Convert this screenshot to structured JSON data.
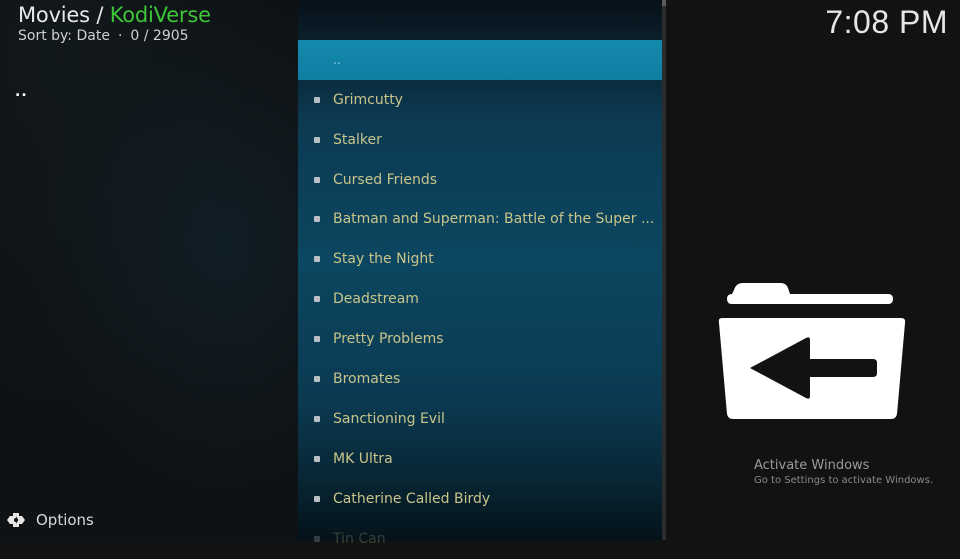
{
  "header": {
    "section": "Movies",
    "separator": " / ",
    "addon": "KodiVerse",
    "sort_label": "Sort by: Date",
    "dot": "·",
    "position": "0 / 2905"
  },
  "clock": "7:08 PM",
  "left_indicator": "..",
  "list": {
    "items": [
      {
        "label": "..",
        "selected": true
      },
      {
        "label": "Grimcutty"
      },
      {
        "label": "Stalker"
      },
      {
        "label": "Cursed Friends"
      },
      {
        "label": "Batman and Superman: Battle of the Super ..."
      },
      {
        "label": "Stay the Night"
      },
      {
        "label": "Deadstream"
      },
      {
        "label": "Pretty Problems"
      },
      {
        "label": "Bromates"
      },
      {
        "label": "Sanctioning Evil"
      },
      {
        "label": "MK Ultra"
      },
      {
        "label": "Catherine Called Birdy"
      },
      {
        "label": "Tin Can"
      }
    ]
  },
  "preview": {
    "icon": "folder-back-icon"
  },
  "watermark": {
    "title": "Activate Windows",
    "subtitle": "Go to Settings to activate Windows."
  },
  "footer": {
    "options_label": "Options",
    "options_icon": "options-gear-icon"
  },
  "colors": {
    "accent_green": "#3ec53a",
    "selected_row": "#1589ad",
    "item_text": "#c9c48a"
  }
}
